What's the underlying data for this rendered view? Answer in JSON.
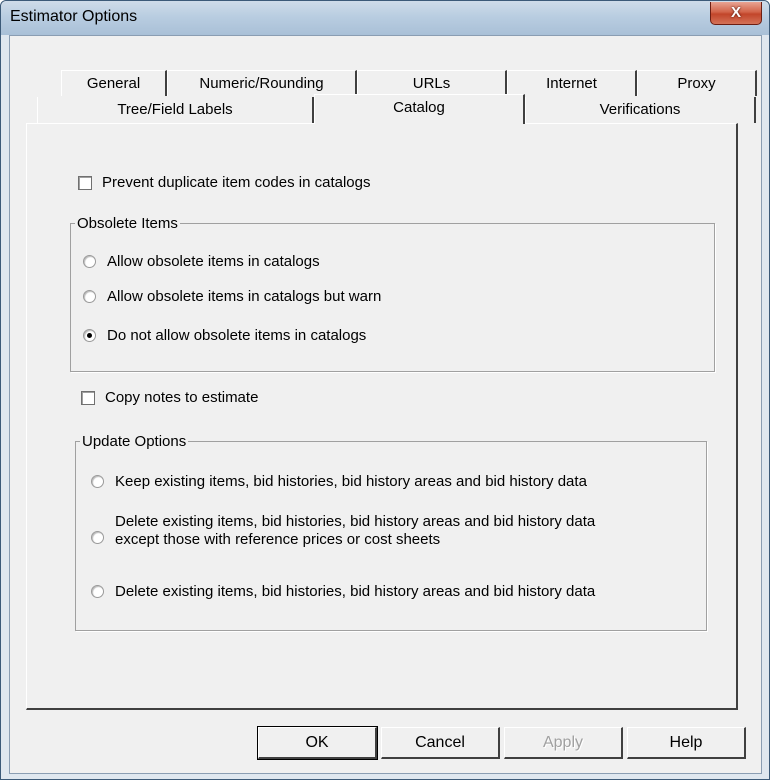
{
  "window": {
    "title": "Estimator Options",
    "close_label": "X"
  },
  "tabs": {
    "back_row": [
      "General",
      "Numeric/Rounding",
      "URLs",
      "Internet",
      "Proxy"
    ],
    "front_row": [
      "Tree/Field Labels",
      "Catalog",
      "Verifications"
    ],
    "selected": "Catalog"
  },
  "catalog": {
    "prevent_duplicates": {
      "label": "Prevent duplicate item codes in catalogs",
      "checked": false
    },
    "obsolete_items": {
      "title": "Obsolete Items",
      "options": [
        {
          "label": "Allow obsolete items in catalogs",
          "selected": false
        },
        {
          "label": "Allow obsolete items in catalogs but warn",
          "selected": false
        },
        {
          "label": "Do not allow obsolete items in catalogs",
          "selected": true
        }
      ]
    },
    "copy_notes": {
      "label": "Copy notes to estimate",
      "checked": false
    },
    "update_options": {
      "title": "Update Options",
      "options": [
        {
          "label": "Keep existing items, bid histories, bid history areas and bid history data",
          "selected": false
        },
        {
          "label_line1": "Delete existing items, bid histories, bid history areas and bid history data",
          "label_line2": "except those with reference prices or cost sheets",
          "selected": false
        },
        {
          "label": "Delete existing items, bid histories, bid history areas and bid history data",
          "selected": false
        }
      ]
    }
  },
  "buttons": {
    "ok": "OK",
    "cancel": "Cancel",
    "apply": "Apply",
    "help": "Help"
  }
}
